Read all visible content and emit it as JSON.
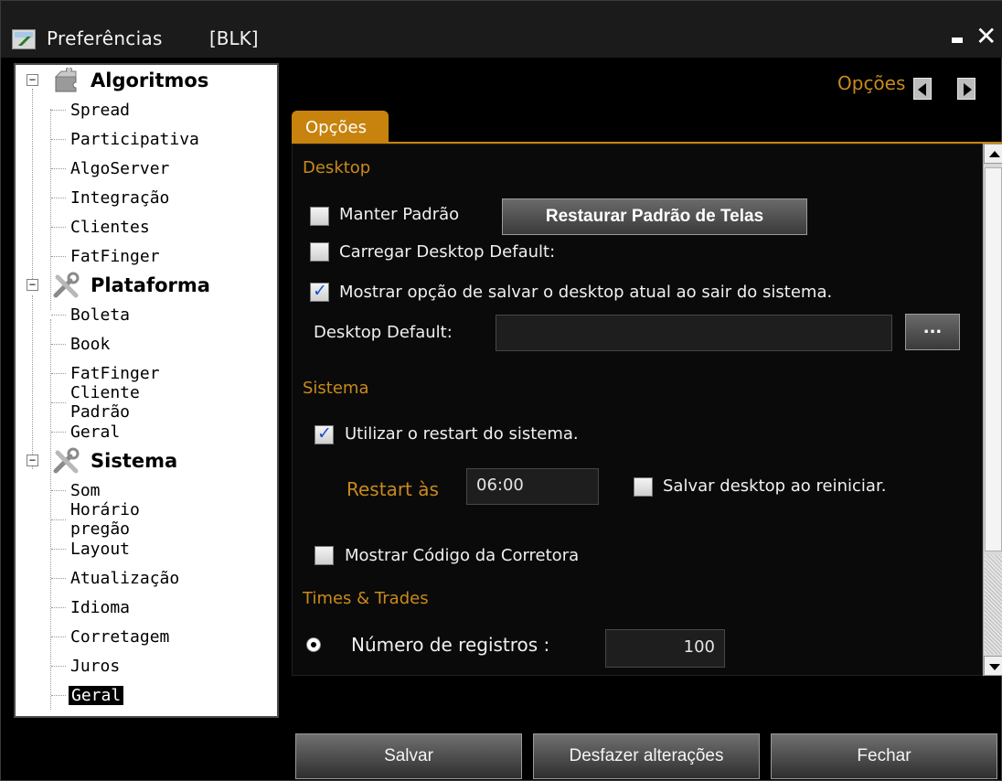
{
  "window": {
    "title": "Preferências",
    "tag": "[BLK]",
    "minimize": "_",
    "close": "✕"
  },
  "tree": {
    "groups": [
      {
        "label": "Algoritmos",
        "items": [
          "Spread",
          "Participativa",
          "AlgoServer",
          "Integração",
          "Clientes",
          "FatFinger"
        ]
      },
      {
        "label": "Plataforma",
        "items": [
          "Boleta",
          "Book",
          "FatFinger",
          "Cliente Padrão",
          "Geral"
        ]
      },
      {
        "label": "Sistema",
        "items": [
          "Som",
          "Horário pregão",
          "Layout",
          "Atualização",
          "Idioma",
          "Corretagem",
          "Juros",
          "Geral"
        ]
      }
    ],
    "selected": "Sistema/Geral"
  },
  "header": {
    "label": "Opções"
  },
  "tab": {
    "label": "Opções"
  },
  "desktop": {
    "section_title": "Desktop",
    "manter_padrao": {
      "label": "Manter Padrão",
      "checked": false
    },
    "restaurar_button": "Restaurar Padrão de Telas",
    "carregar_default": {
      "label": "Carregar Desktop Default:",
      "checked": false
    },
    "mostrar_opcao": {
      "label": "Mostrar opção de salvar o desktop atual ao sair do sistema.",
      "checked": true
    },
    "desktop_default_label": "Desktop Default:",
    "desktop_default_value": "",
    "browse_button": "..."
  },
  "sistema": {
    "section_title": "Sistema",
    "utilizar_restart": {
      "label": "Utilizar o restart do sistema.",
      "checked": true
    },
    "restart_as_label": "Restart às",
    "restart_time": "06:00",
    "salvar_desktop": {
      "label": "Salvar desktop ao reiniciar.",
      "checked": false
    },
    "mostrar_codigo": {
      "label": "Mostrar Código da Corretora",
      "checked": false
    }
  },
  "times_trades": {
    "section_title": "Times & Trades",
    "numero_registros_label": "Número de registros :",
    "numero_registros_value": "100"
  },
  "footer": {
    "salvar": "Salvar",
    "desfazer": "Desfazer alterações",
    "fechar": "Fechar"
  },
  "colors": {
    "accent": "#c7830d",
    "background": "#000000",
    "tree_bg": "#ffffff"
  }
}
